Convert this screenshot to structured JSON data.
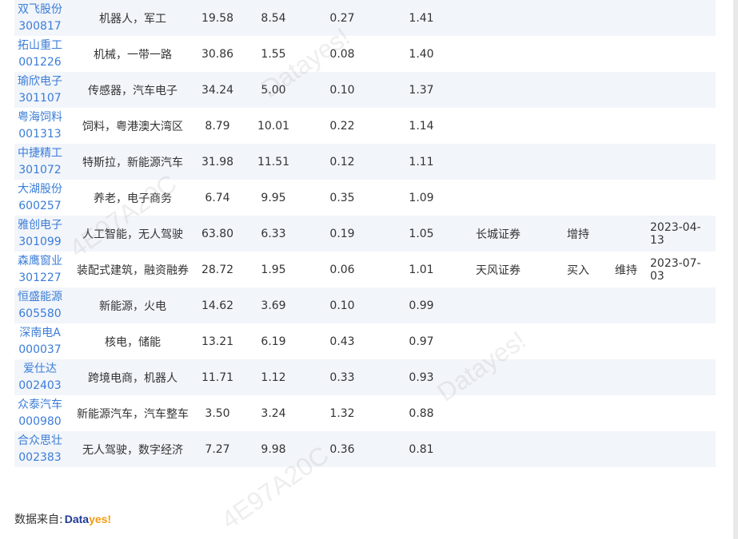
{
  "rows": [
    {
      "name": "双飞股份",
      "code": "300817",
      "concept": "机器人，军工",
      "pe": "19.58",
      "pb": "8.54",
      "ratio": "0.27",
      "score": "1.41",
      "broker": "",
      "rating": "",
      "change": "",
      "date": ""
    },
    {
      "name": "拓山重工",
      "code": "001226",
      "concept": "机械，一带一路",
      "pe": "30.86",
      "pb": "1.55",
      "ratio": "0.08",
      "score": "1.40",
      "broker": "",
      "rating": "",
      "change": "",
      "date": ""
    },
    {
      "name": "瑜欣电子",
      "code": "301107",
      "concept": "传感器，汽车电子",
      "pe": "34.24",
      "pb": "5.00",
      "ratio": "0.10",
      "score": "1.37",
      "broker": "",
      "rating": "",
      "change": "",
      "date": ""
    },
    {
      "name": "粤海饲料",
      "code": "001313",
      "concept": "饲料，粤港澳大湾区",
      "pe": "8.79",
      "pb": "10.01",
      "ratio": "0.22",
      "score": "1.14",
      "broker": "",
      "rating": "",
      "change": "",
      "date": ""
    },
    {
      "name": "中捷精工",
      "code": "301072",
      "concept": "特斯拉，新能源汽车",
      "pe": "31.98",
      "pb": "11.51",
      "ratio": "0.12",
      "score": "1.11",
      "broker": "",
      "rating": "",
      "change": "",
      "date": ""
    },
    {
      "name": "大湖股份",
      "code": "600257",
      "concept": "养老，电子商务",
      "pe": "6.74",
      "pb": "9.95",
      "ratio": "0.35",
      "score": "1.09",
      "broker": "",
      "rating": "",
      "change": "",
      "date": ""
    },
    {
      "name": "雅创电子",
      "code": "301099",
      "concept": "人工智能，无人驾驶",
      "pe": "63.80",
      "pb": "6.33",
      "ratio": "0.19",
      "score": "1.05",
      "broker": "长城证券",
      "rating": "增持",
      "change": "",
      "date": "2023-04-13"
    },
    {
      "name": "森鹰窗业",
      "code": "301227",
      "concept": "装配式建筑，融资融券",
      "pe": "28.72",
      "pb": "1.95",
      "ratio": "0.06",
      "score": "1.01",
      "broker": "天风证券",
      "rating": "买入",
      "change": "维持",
      "date": "2023-07-03"
    },
    {
      "name": "恒盛能源",
      "code": "605580",
      "concept": "新能源，火电",
      "pe": "14.62",
      "pb": "3.69",
      "ratio": "0.10",
      "score": "0.99",
      "broker": "",
      "rating": "",
      "change": "",
      "date": ""
    },
    {
      "name": "深南电A",
      "code": "000037",
      "concept": "核电，储能",
      "pe": "13.21",
      "pb": "6.19",
      "ratio": "0.43",
      "score": "0.97",
      "broker": "",
      "rating": "",
      "change": "",
      "date": ""
    },
    {
      "name": "爱仕达",
      "code": "002403",
      "concept": "跨境电商，机器人",
      "pe": "11.71",
      "pb": "1.12",
      "ratio": "0.33",
      "score": "0.93",
      "broker": "",
      "rating": "",
      "change": "",
      "date": ""
    },
    {
      "name": "众泰汽车",
      "code": "000980",
      "concept": "新能源汽车，汽车整车",
      "pe": "3.50",
      "pb": "3.24",
      "ratio": "1.32",
      "score": "0.88",
      "broker": "",
      "rating": "",
      "change": "",
      "date": ""
    },
    {
      "name": "合众思壮",
      "code": "002383",
      "concept": "无人驾驶，数字经济",
      "pe": "7.27",
      "pb": "9.98",
      "ratio": "0.36",
      "score": "0.81",
      "broker": "",
      "rating": "",
      "change": "",
      "date": ""
    }
  ],
  "footer": {
    "source_label": "数据来自:",
    "logo_part1": "Data",
    "logo_part2": "yes!"
  },
  "watermarks": [
    "Datayes!",
    "4E97A20C",
    "Datayes!",
    "4E97A20C"
  ]
}
